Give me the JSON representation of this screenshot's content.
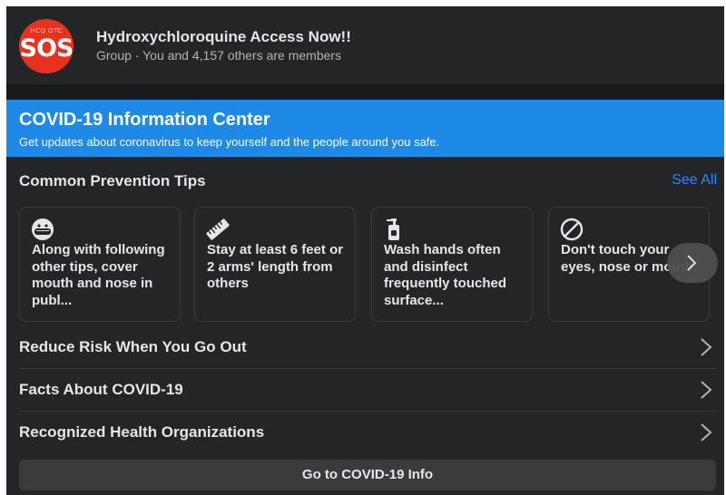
{
  "group": {
    "avatar_small_text": "HCQ OTC",
    "avatar_text": "SOS",
    "name": "Hydroxychloroquine Access Now!!",
    "meta": "Group · You and 4,157 others are members"
  },
  "covid": {
    "title": "COVID-19 Information Center",
    "subtitle": "Get updates about coronavirus to keep yourself and the people around you safe.",
    "tips_title": "Common Prevention Tips",
    "see_all": "See All",
    "tips": [
      {
        "icon": "face-mask-icon",
        "text": "Along with following other tips, cover mouth and nose in publ..."
      },
      {
        "icon": "ruler-icon",
        "text": "Stay at least 6 feet or 2 arms' length from others"
      },
      {
        "icon": "soap-bottle-icon",
        "text": "Wash hands often and disinfect frequently touched surface..."
      },
      {
        "icon": "no-touch-icon",
        "text": "Don't touch your eyes, nose or mouth"
      }
    ],
    "rows": [
      {
        "label": "Reduce Risk When You Go Out"
      },
      {
        "label": "Facts About COVID-19"
      },
      {
        "label": "Recognized Health Organizations"
      }
    ],
    "go_button": "Go to COVID-19 Info"
  },
  "colors": {
    "banner": "#1d8ae8",
    "background": "#18191a",
    "card": "#242526",
    "link": "#2d88ff",
    "avatar": "#e8321e"
  }
}
